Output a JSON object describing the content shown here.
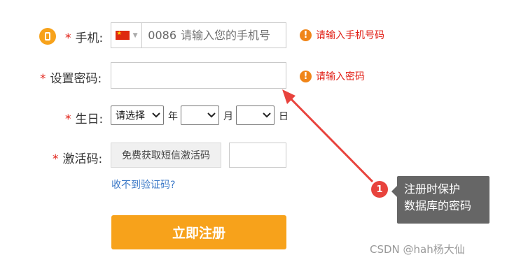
{
  "form": {
    "phone": {
      "label": "手机:",
      "required": "*",
      "country_code": "0086",
      "placeholder": "请输入您的手机号",
      "error": "请输入手机号码"
    },
    "password": {
      "label": "设置密码:",
      "required": "*",
      "value": "",
      "error": "请输入密码"
    },
    "birthday": {
      "label": "生日:",
      "required": "*",
      "year_select": "请选择",
      "year_unit": "年",
      "month_unit": "月",
      "day_unit": "日"
    },
    "activation": {
      "label": "激活码:",
      "required": "*",
      "get_code_button": "免费获取短信激活码",
      "code_not_received": "收不到验证码?"
    },
    "submit_label": "立即注册"
  },
  "annotation": {
    "step_number": "1",
    "line1": "注册时保护",
    "line2": "数据库的密码"
  },
  "watermark": "CSDN @hah杨大仙",
  "colors": {
    "required_star": "#e2231a",
    "error_text": "#e2231a",
    "error_icon": "#f08519",
    "submit_bg": "#f7a21b",
    "arrow": "#e8433d",
    "link": "#3d7ac8",
    "tooltip_bg": "#666666"
  }
}
